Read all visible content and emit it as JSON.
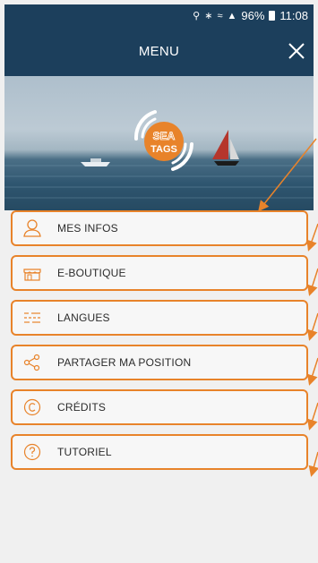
{
  "status_bar": {
    "battery": "96%",
    "time": "11:08"
  },
  "header": {
    "title": "MENU"
  },
  "hero": {
    "logo_top": "SEA",
    "logo_bottom": "TAGS"
  },
  "menu": {
    "items": [
      {
        "label": "MES INFOS",
        "icon": "user-icon"
      },
      {
        "label": "E-BOUTIQUE",
        "icon": "shop-icon"
      },
      {
        "label": "LANGUES",
        "icon": "list-icon"
      },
      {
        "label": "PARTAGER MA POSITION",
        "icon": "share-icon"
      },
      {
        "label": "CRÉDITS",
        "icon": "copyright-icon"
      },
      {
        "label": "TUTORIEL",
        "icon": "help-icon"
      }
    ]
  },
  "colors": {
    "header_bg": "#1c3f5c",
    "accent": "#e8832a"
  }
}
